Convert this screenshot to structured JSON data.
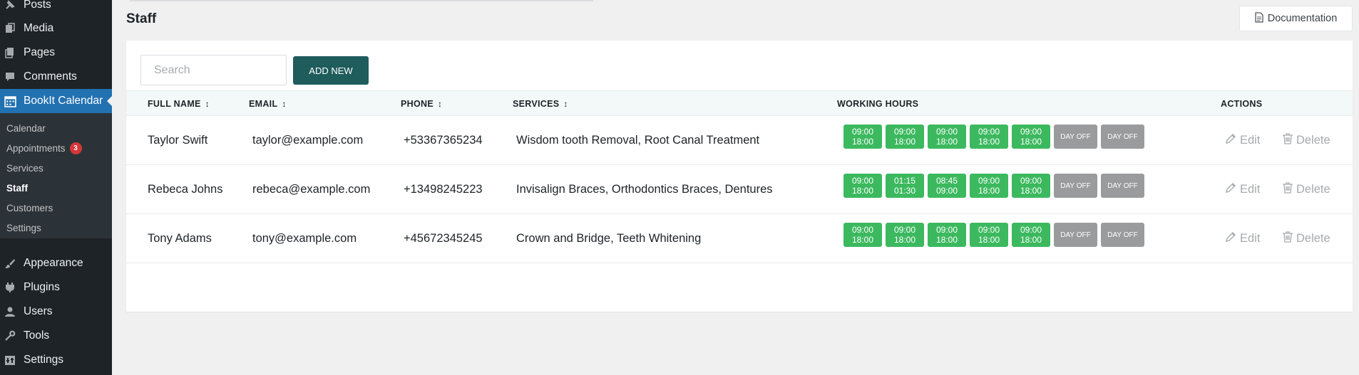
{
  "sidebar": {
    "menu": [
      {
        "label": "Posts",
        "icon": "pin-icon"
      },
      {
        "label": "Media",
        "icon": "media-icon"
      },
      {
        "label": "Pages",
        "icon": "pages-icon"
      },
      {
        "label": "Comments",
        "icon": "comments-icon"
      },
      {
        "label": "BookIt Calendar",
        "icon": "calendar-icon"
      },
      {
        "label": "Appearance",
        "icon": "brush-icon"
      },
      {
        "label": "Plugins",
        "icon": "plugin-icon"
      },
      {
        "label": "Users",
        "icon": "user-icon"
      },
      {
        "label": "Tools",
        "icon": "wrench-icon"
      },
      {
        "label": "Settings",
        "icon": "settings-icon"
      }
    ],
    "submenu": [
      {
        "label": "Calendar"
      },
      {
        "label": "Appointments",
        "badge": "3"
      },
      {
        "label": "Services"
      },
      {
        "label": "Staff"
      },
      {
        "label": "Customers"
      },
      {
        "label": "Settings"
      }
    ]
  },
  "page": {
    "title": "Staff",
    "doc_button": "Documentation",
    "search_placeholder": "Search",
    "add_new": "ADD NEW"
  },
  "table": {
    "headers": {
      "full_name": "FULL NAME",
      "email": "EMAIL",
      "phone": "PHONE",
      "services": "SERVICES",
      "working_hours": "WORKING HOURS",
      "actions": "ACTIONS"
    },
    "edit_label": "Edit",
    "delete_label": "Delete",
    "rows": [
      {
        "name": "Taylor Swift",
        "email": "taylor@example.com",
        "phone": "+53367365234",
        "services": "Wisdom tooth Removal, Root Canal Treatment",
        "hours": [
          {
            "start": "09:00",
            "end": "18:00"
          },
          {
            "start": "09:00",
            "end": "18:00"
          },
          {
            "start": "09:00",
            "end": "18:00"
          },
          {
            "start": "09:00",
            "end": "18:00"
          },
          {
            "start": "09:00",
            "end": "18:00"
          }
        ],
        "days_off": [
          "DAY OFF",
          "DAY OFF"
        ]
      },
      {
        "name": "Rebeca Johns",
        "email": "rebeca@example.com",
        "phone": "+13498245223",
        "services": "Invisalign Braces, Orthodontics Braces, Dentures",
        "hours": [
          {
            "start": "09:00",
            "end": "18:00"
          },
          {
            "start": "01:15",
            "end": "01:30"
          },
          {
            "start": "08:45",
            "end": "09:00"
          },
          {
            "start": "09:00",
            "end": "18:00"
          },
          {
            "start": "09:00",
            "end": "18:00"
          }
        ],
        "days_off": [
          "DAY OFF",
          "DAY OFF"
        ]
      },
      {
        "name": "Tony Adams",
        "email": "tony@example.com",
        "phone": "+45672345245",
        "services": "Crown and Bridge, Teeth Whitening",
        "hours": [
          {
            "start": "09:00",
            "end": "18:00"
          },
          {
            "start": "09:00",
            "end": "18:00"
          },
          {
            "start": "09:00",
            "end": "18:00"
          },
          {
            "start": "09:00",
            "end": "18:00"
          },
          {
            "start": "09:00",
            "end": "18:00"
          }
        ],
        "days_off": [
          "DAY OFF",
          "DAY OFF"
        ]
      }
    ]
  },
  "colors": {
    "sidebar_bg": "#1d2327",
    "active_menu": "#2271b1",
    "add_button": "#1f5c5c",
    "slot_green": "#3cb95f",
    "day_off_gray": "#999b9d"
  }
}
